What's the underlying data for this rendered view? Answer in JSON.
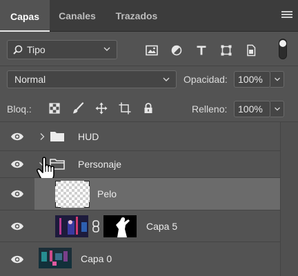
{
  "tabs": [
    {
      "label": "Capas",
      "active": true
    },
    {
      "label": "Canales",
      "active": false
    },
    {
      "label": "Trazados",
      "active": false
    }
  ],
  "filter": {
    "label": "Tipo",
    "icon": "search-icon"
  },
  "filter_icons": [
    "image-filter-icon",
    "adjustment-filter-icon",
    "text-filter-icon",
    "shape-filter-icon",
    "smart-object-filter-icon"
  ],
  "blend_mode": "Normal",
  "opacity": {
    "label": "Opacidad:",
    "value": "100%"
  },
  "lock": {
    "label": "Bloq.:",
    "icons": [
      "lock-transparent-pixels-icon",
      "lock-image-pixels-icon",
      "lock-position-icon",
      "lock-artboard-icon",
      "lock-all-icon"
    ]
  },
  "fill": {
    "label": "Relleno:",
    "value": "100%"
  },
  "layers": [
    {
      "name": "HUD",
      "type": "group",
      "expanded": false
    },
    {
      "name": "Personaje",
      "type": "group",
      "expanded": true
    },
    {
      "name": "Pelo",
      "type": "pixel",
      "selected": true
    },
    {
      "name": "Capa 5",
      "type": "masked"
    },
    {
      "name": "Capa 0",
      "type": "pixel"
    }
  ],
  "colors": {
    "panel": "#535353",
    "tabbar": "#3c3c3c",
    "selected_row": "#6b6b6b"
  }
}
